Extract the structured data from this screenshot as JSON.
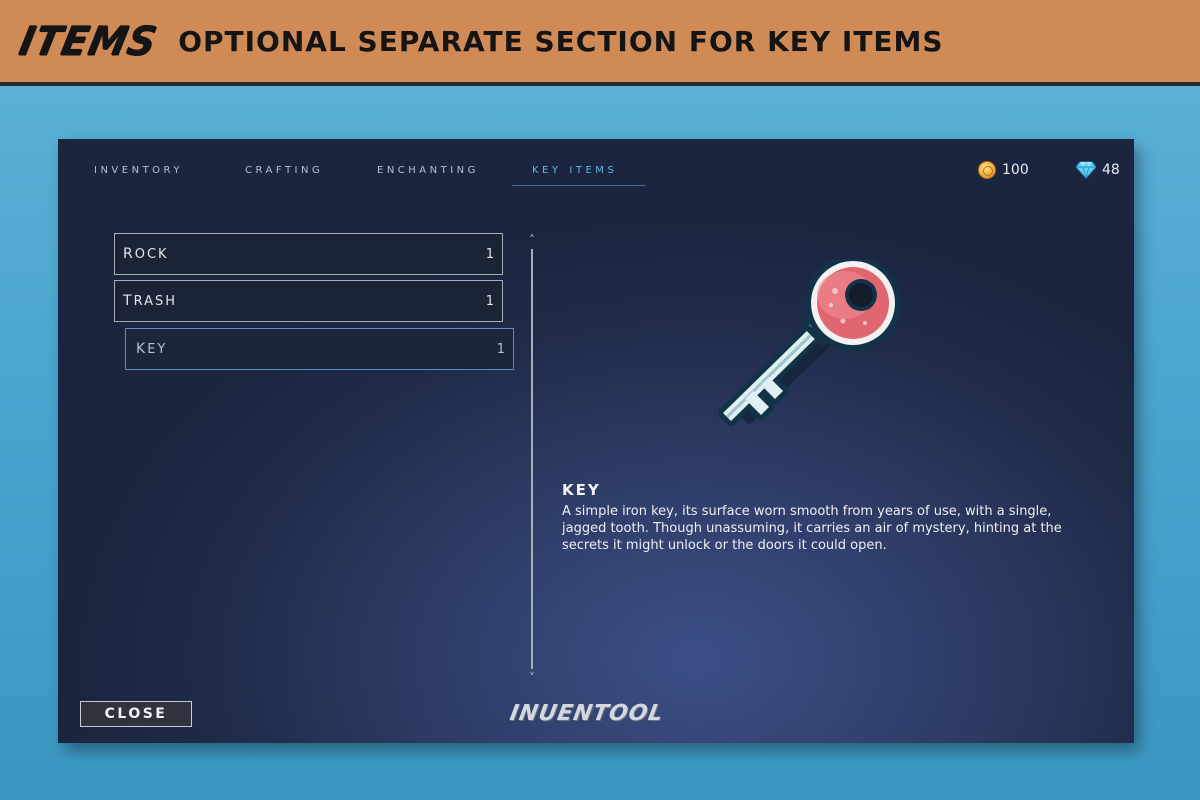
{
  "banner": {
    "logo_text": "ITEMS",
    "title": "OPTIONAL SEPARATE SECTION FOR KEY ITEMS"
  },
  "tabs": [
    {
      "label": "Inventory",
      "active": false
    },
    {
      "label": "Crafting",
      "active": false
    },
    {
      "label": "Enchanting",
      "active": false
    },
    {
      "label": "Key Items",
      "active": true
    }
  ],
  "currencies": {
    "coins": {
      "icon": "coin-stack-icon",
      "value": "100"
    },
    "gems": {
      "icon": "diamond-icon",
      "value": "48"
    }
  },
  "items": [
    {
      "name": "Rock",
      "count": "1",
      "selected": false
    },
    {
      "name": "Trash",
      "count": "1",
      "selected": false
    },
    {
      "name": "Key",
      "count": "1",
      "selected": true
    }
  ],
  "detail": {
    "icon": "key-icon",
    "title": "Key",
    "description": "A simple iron key, its surface worn smooth from years of use, with a single, jagged tooth. Though unassuming, it carries an air of mystery, hinting at the secrets it might unlock or the doors it could open."
  },
  "footer": {
    "close_label": "Close",
    "brand": "INUENTOOL"
  },
  "colors": {
    "banner": "#cf8a55",
    "accent": "#63b6e8",
    "window_bg": "#1f2a47",
    "key_red": "#e0666f"
  }
}
